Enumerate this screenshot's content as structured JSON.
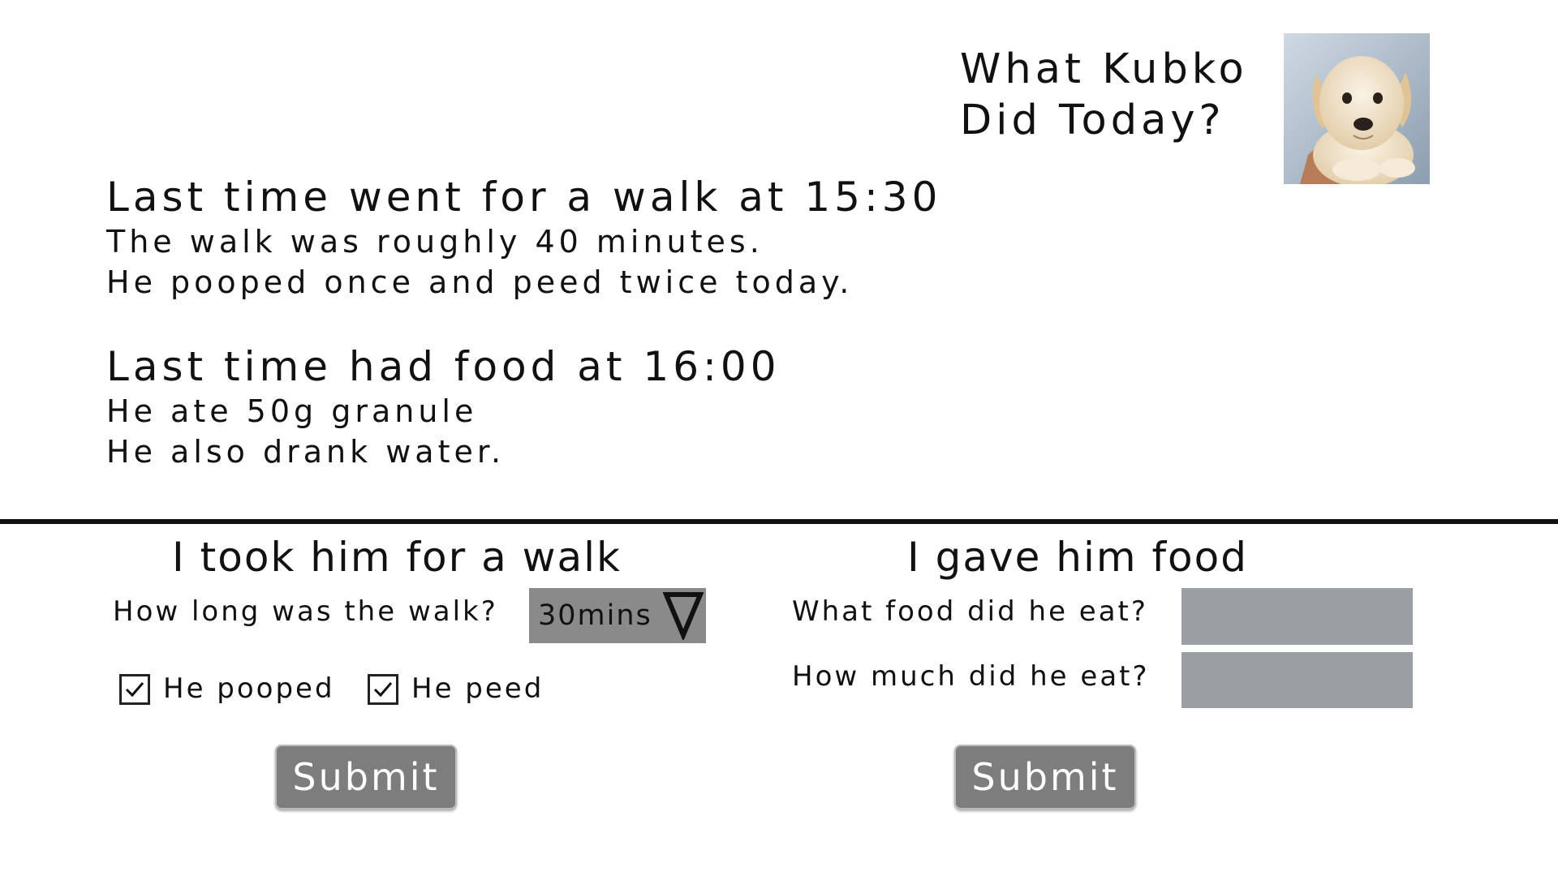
{
  "header": {
    "title_line1": "What Kubko",
    "title_line2": "Did Today?",
    "photo_icon": "puppy-photo"
  },
  "walk_summary": {
    "heading": "Last time went for a walk at 15:30",
    "line1": "The walk was roughly 40 minutes.",
    "line2": "He pooped once and peed twice today."
  },
  "food_summary": {
    "heading": "Last time had food at 16:00",
    "line1": "He ate 50g granule",
    "line2": "He also drank water."
  },
  "walk_form": {
    "heading": "I took him for a walk",
    "duration_label": "How long was the walk?",
    "duration_value": "30mins",
    "dropdown_icon": "triangle-down-icon",
    "pooped_label": "He pooped",
    "pooped_checked": true,
    "peed_label": "He peed",
    "peed_checked": true,
    "submit_label": "Submit"
  },
  "food_form": {
    "heading": "I gave him food",
    "food_label": "What food did he eat?",
    "food_value": "",
    "amount_label": "How much did he eat?",
    "amount_value": "",
    "submit_label": "Submit"
  },
  "colors": {
    "input_bg": "#9b9ea3",
    "select_bg": "#8a8a8a",
    "button_bg": "#7d7d7d"
  }
}
